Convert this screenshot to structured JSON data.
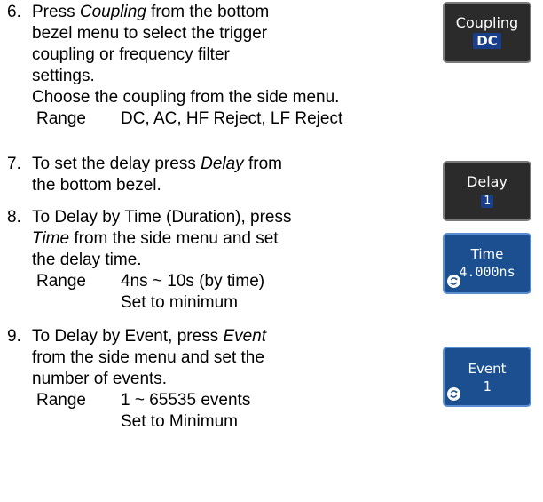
{
  "steps": [
    {
      "number": "6.",
      "lines": [
        [
          "Press ",
          "Coupling",
          " from the bottom"
        ],
        [
          "bezel menu to select the trigger"
        ],
        [
          "coupling or frequency filter"
        ],
        [
          "settings."
        ],
        [
          "Choose the coupling from the side menu."
        ]
      ],
      "range": {
        "label": "Range",
        "values": [
          "DC, AC, HF Reject, LF Reject"
        ]
      }
    },
    {
      "number": "7.",
      "lines": [
        [
          "To set the delay press ",
          "Delay",
          " from"
        ],
        [
          "the bottom bezel."
        ]
      ]
    },
    {
      "number": "8.",
      "lines": [
        [
          "To Delay by Time (Duration), press"
        ],
        [
          "",
          "Time",
          " from the side menu and set"
        ],
        [
          "the delay time."
        ]
      ],
      "range": {
        "label": "Range",
        "values": [
          "4ns ~ 10s (by time)",
          "Set to minimum"
        ]
      }
    },
    {
      "number": "9.",
      "lines": [
        [
          "To Delay by Event, press ",
          "Event"
        ],
        [
          "from the side menu and set the"
        ],
        [
          "number of events."
        ]
      ],
      "range": {
        "label": "Range",
        "values": [
          "1 ~ 65535  events",
          "Set to Minimum"
        ]
      }
    }
  ],
  "buttons": {
    "coupling": {
      "title": "Coupling",
      "value": "DC"
    },
    "delay": {
      "title": "Delay",
      "value": "1"
    },
    "time": {
      "title": "Time",
      "value": "4.000ns"
    },
    "event": {
      "title": "Event",
      "value": "1"
    }
  },
  "colors": {
    "bezel_dark": "#2b2b2b",
    "bezel_blue": "#1b4f8f",
    "value_chip": "#1a3f8a"
  },
  "icons": {
    "variable_knob": "knob-icon"
  }
}
